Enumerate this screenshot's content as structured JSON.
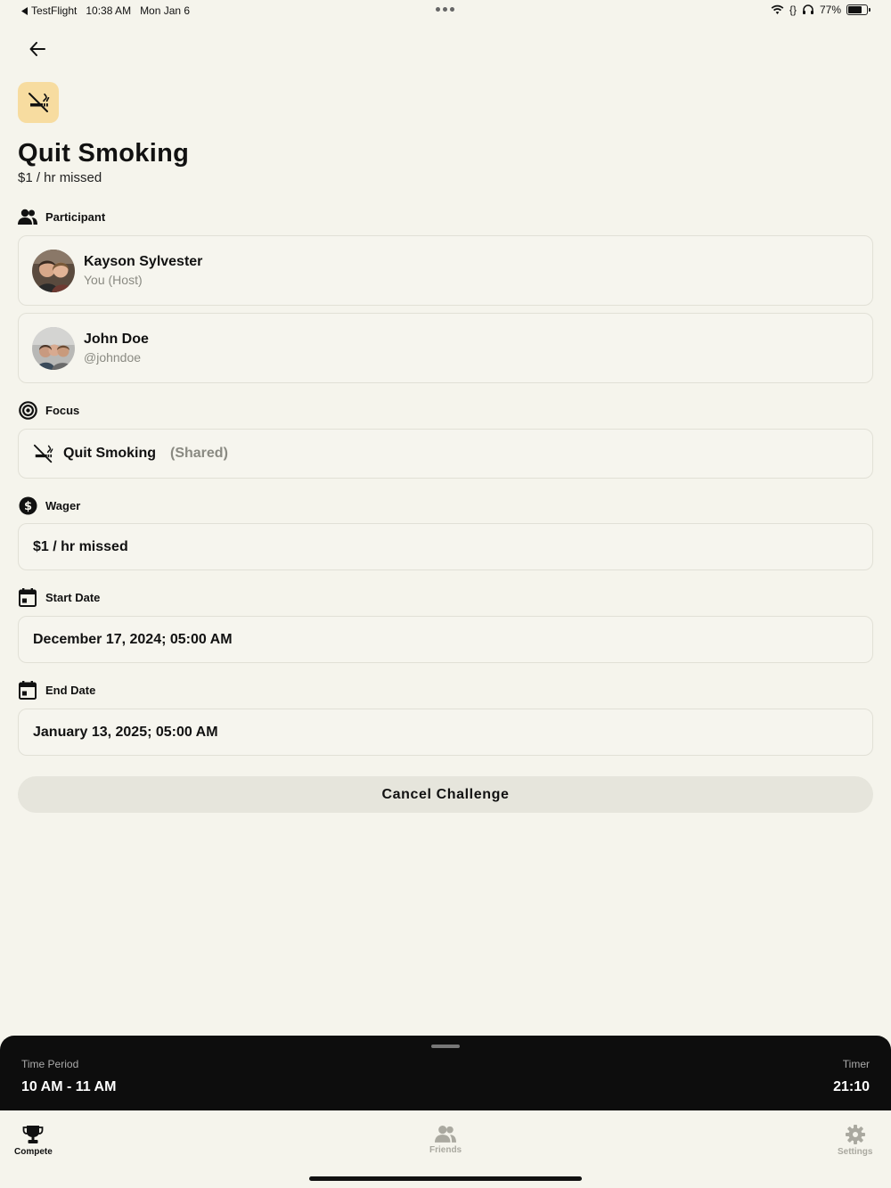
{
  "status_bar": {
    "back_app": "TestFlight",
    "time": "10:38 AM",
    "date": "Mon Jan 6",
    "battery": "77%",
    "battery_level": 0.77
  },
  "header": {
    "title": "Quit Smoking",
    "subtitle": "$1 / hr missed",
    "hero_icon": "no-smoking-icon",
    "hero_icon_bg": "#f7dca0"
  },
  "participants": {
    "section_label": "Participant",
    "items": [
      {
        "name": "Kayson Sylvester",
        "sub": "You (Host)"
      },
      {
        "name": "John Doe",
        "sub": "@johndoe"
      }
    ]
  },
  "focus": {
    "section_label": "Focus",
    "label": "Quit Smoking",
    "tag": "(Shared)"
  },
  "wager": {
    "section_label": "Wager",
    "value": "$1 / hr missed"
  },
  "start_date": {
    "section_label": "Start Date",
    "value": "December 17, 2024; 05:00 AM"
  },
  "end_date": {
    "section_label": "End Date",
    "value": "January 13, 2025; 05:00 AM"
  },
  "cancel_label": "Cancel Challenge",
  "bottom_sheet": {
    "time_period_label": "Time Period",
    "time_period_value": "10 AM - 11 AM",
    "timer_label": "Timer",
    "timer_value": "21:10"
  },
  "tabs": [
    {
      "label": "Compete",
      "icon": "trophy-icon",
      "active": true
    },
    {
      "label": "Friends",
      "icon": "friends-icon",
      "active": false
    },
    {
      "label": "Settings",
      "icon": "gear-icon",
      "active": false
    }
  ]
}
